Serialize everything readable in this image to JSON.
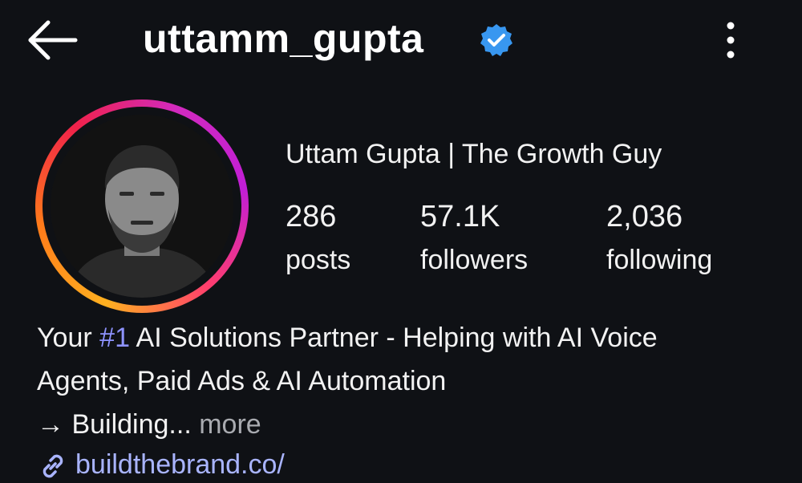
{
  "header": {
    "username": "uttamm_gupta",
    "back_icon": "arrow-left-icon",
    "verified_icon": "verified-badge-icon",
    "more_icon": "more-vertical-icon"
  },
  "profile": {
    "display_name": "Uttam Gupta | The Growth Guy",
    "stats": [
      {
        "value": "286",
        "label": "posts"
      },
      {
        "value": "57.1K",
        "label": "followers"
      },
      {
        "value": "2,036",
        "label": "following"
      }
    ]
  },
  "bio": {
    "line1_prefix": "Your ",
    "line1_highlight": "#1",
    "line1_suffix": " AI Solutions Partner - Helping with AI Voice",
    "line2": "Agents, Paid Ads & AI Automation",
    "line3_arrow": "→",
    "line3_text": " Building...",
    "more_label": " more",
    "link_icon": "link-icon",
    "link_text": "buildthebrand.co/"
  },
  "colors": {
    "background": "#0f1115",
    "verified_blue": "#3897f0",
    "hashtag": "#8e93ff",
    "link": "#a9b4ff"
  }
}
